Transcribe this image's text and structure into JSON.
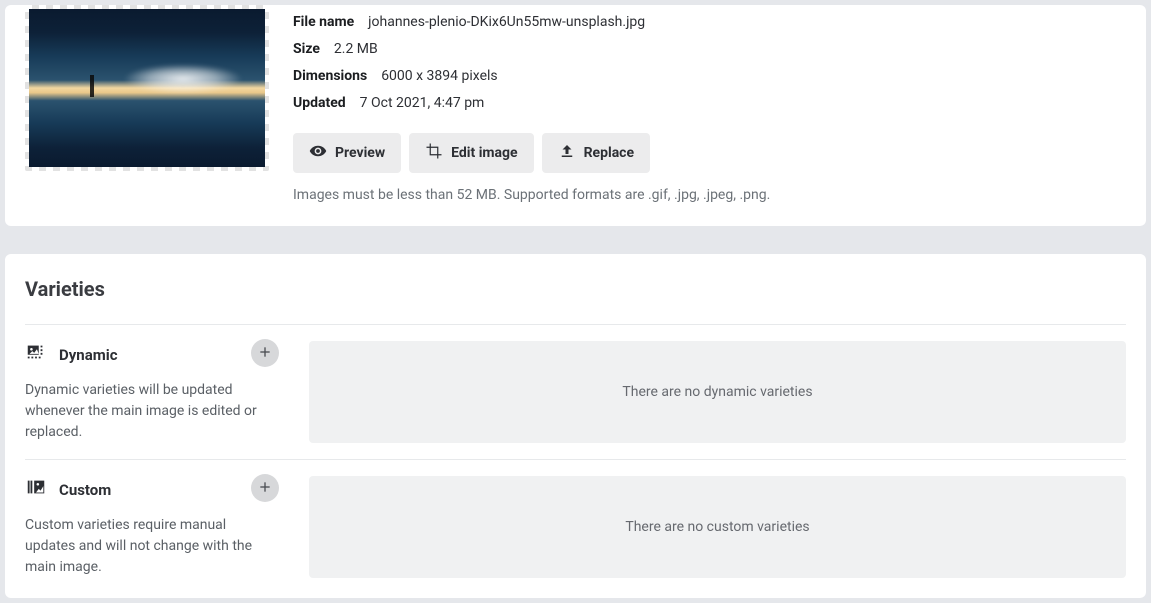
{
  "file": {
    "labels": {
      "filename": "File name",
      "size": "Size",
      "dimensions": "Dimensions",
      "updated": "Updated"
    },
    "values": {
      "filename": "johannes-plenio-DKix6Un55mw-unsplash.jpg",
      "size": "2.2 MB",
      "dimensions": "6000 x 3894 pixels",
      "updated": "7 Oct 2021, 4:47 pm"
    },
    "buttons": {
      "preview": "Preview",
      "edit": "Edit image",
      "replace": "Replace"
    },
    "hint": "Images must be less than 52 MB. Supported formats are .gif, .jpg, .jpeg, .png."
  },
  "varieties": {
    "title": "Varieties",
    "dynamic": {
      "title": "Dynamic",
      "desc": "Dynamic varieties will be updated whenever the main image is edited or replaced.",
      "empty": "There are no dynamic varieties"
    },
    "custom": {
      "title": "Custom",
      "desc": "Custom varieties require manual updates and will not change with the main image.",
      "empty": "There are no custom varieties"
    }
  }
}
